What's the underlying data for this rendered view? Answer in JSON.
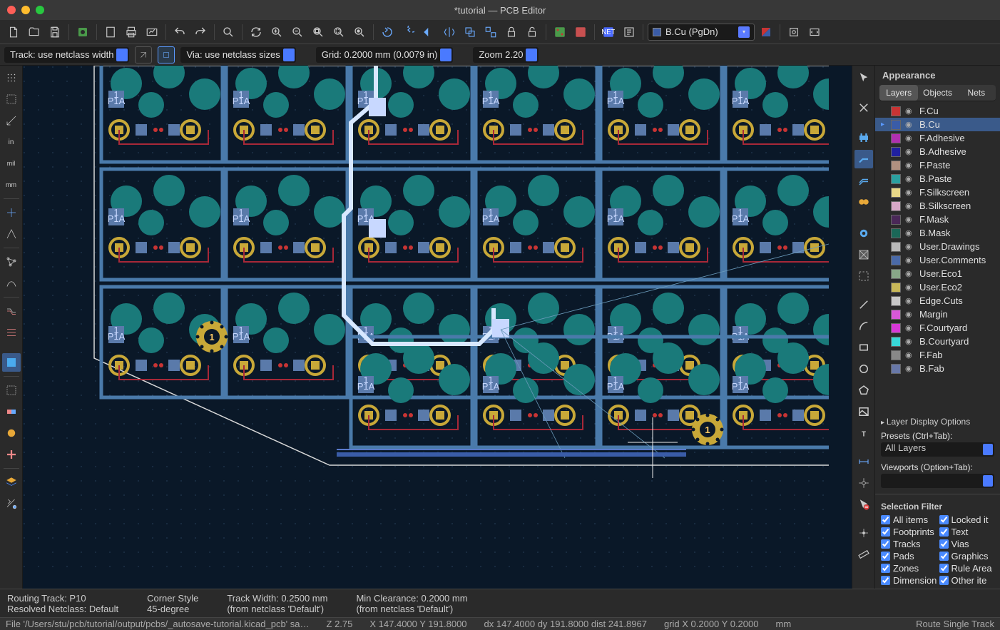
{
  "window": {
    "title": "*tutorial — PCB Editor"
  },
  "toolbar": {
    "layer_select": "B.Cu (PgDn)"
  },
  "optbar": {
    "track": "Track: use netclass width",
    "via": "Via: use netclass sizes",
    "grid": "Grid: 0.2000 mm (0.0079 in)",
    "zoom": "Zoom 2.20"
  },
  "appearance": {
    "title": "Appearance",
    "tabs": [
      "Layers",
      "Objects",
      "Nets"
    ],
    "active_tab": 0,
    "layers": [
      {
        "name": "F.Cu",
        "color": "#c83434",
        "sel": false
      },
      {
        "name": "B.Cu",
        "color": "#3a5ca8",
        "sel": true
      },
      {
        "name": "F.Adhesive",
        "color": "#b030b0",
        "sel": false
      },
      {
        "name": "B.Adhesive",
        "color": "#2020a0",
        "sel": false
      },
      {
        "name": "F.Paste",
        "color": "#b09080",
        "sel": false
      },
      {
        "name": "B.Paste",
        "color": "#2aa0a0",
        "sel": false
      },
      {
        "name": "F.Silkscreen",
        "color": "#e8d888",
        "sel": false
      },
      {
        "name": "B.Silkscreen",
        "color": "#d8a8c8",
        "sel": false
      },
      {
        "name": "F.Mask",
        "color": "#4a2858",
        "sel": false
      },
      {
        "name": "B.Mask",
        "color": "#1a6858",
        "sel": false
      },
      {
        "name": "User.Drawings",
        "color": "#b8b8b8",
        "sel": false
      },
      {
        "name": "User.Comments",
        "color": "#4a6aa8",
        "sel": false
      },
      {
        "name": "User.Eco1",
        "color": "#88a888",
        "sel": false
      },
      {
        "name": "User.Eco2",
        "color": "#c8b858",
        "sel": false
      },
      {
        "name": "Edge.Cuts",
        "color": "#c8c8c8",
        "sel": false
      },
      {
        "name": "Margin",
        "color": "#d858d8",
        "sel": false
      },
      {
        "name": "F.Courtyard",
        "color": "#d838d8",
        "sel": false
      },
      {
        "name": "B.Courtyard",
        "color": "#38d8d8",
        "sel": false
      },
      {
        "name": "F.Fab",
        "color": "#888888",
        "sel": false
      },
      {
        "name": "B.Fab",
        "color": "#6878a8",
        "sel": false
      }
    ],
    "layer_display": "Layer Display Options",
    "presets_label": "Presets (Ctrl+Tab):",
    "presets_value": "All Layers",
    "viewports_label": "Viewports (Option+Tab):",
    "viewports_value": ""
  },
  "selfilter": {
    "title": "Selection Filter",
    "items": [
      {
        "label": "All items",
        "checked": true
      },
      {
        "label": "Locked it",
        "checked": true
      },
      {
        "label": "Footprints",
        "checked": true
      },
      {
        "label": "Text",
        "checked": true
      },
      {
        "label": "Tracks",
        "checked": true
      },
      {
        "label": "Vias",
        "checked": true
      },
      {
        "label": "Pads",
        "checked": true
      },
      {
        "label": "Graphics",
        "checked": true
      },
      {
        "label": "Zones",
        "checked": true
      },
      {
        "label": "Rule Area",
        "checked": true
      },
      {
        "label": "Dimensions",
        "checked": true
      },
      {
        "label": "Other ite",
        "checked": true
      }
    ]
  },
  "info": {
    "col1a": "Routing Track: P10",
    "col1b": "Resolved Netclass: Default",
    "col2a": "Corner Style",
    "col2b": "45-degree",
    "col3a": "Track Width: 0.2500 mm",
    "col3b": "(from netclass 'Default')",
    "col4a": "Min Clearance: 0.2000 mm",
    "col4b": "(from netclass 'Default')"
  },
  "status": {
    "file": "File '/Users/stu/pcb/tutorial/output/pcbs/_autosave-tutorial.kicad_pcb' sa…",
    "z": "Z 2.75",
    "xy": "X 147.4000  Y 191.8000",
    "dxy": "dx 147.4000  dy 191.8000  dist 241.8967",
    "grid": "grid X 0.2000  Y 0.2000",
    "units": "mm",
    "mode": "Route Single Track"
  }
}
